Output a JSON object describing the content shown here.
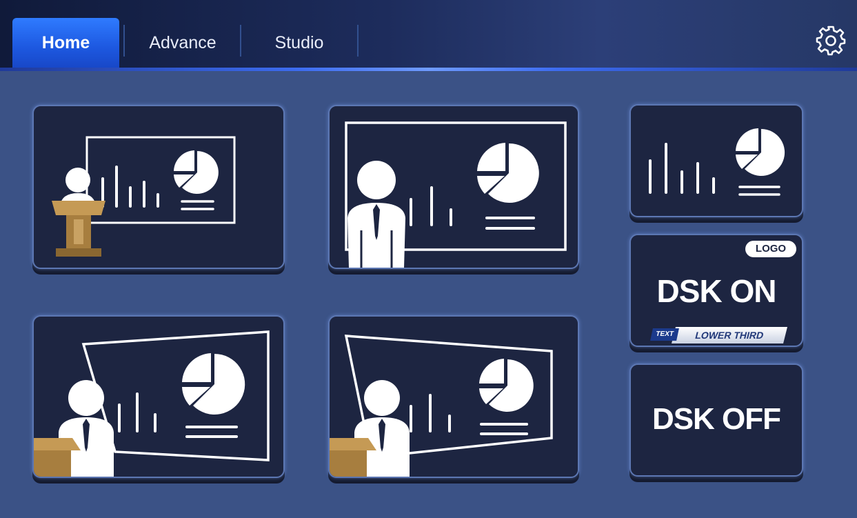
{
  "tabs": [
    {
      "label": "Home",
      "active": true
    },
    {
      "label": "Advance",
      "active": false
    },
    {
      "label": "Studio",
      "active": false
    }
  ],
  "settings_icon": "gear-icon",
  "layouts": [
    {
      "name": "presenter-podium-small-screen",
      "icons": [
        "presenter-icon",
        "podium-icon",
        "bar-chart-icon",
        "pie-chart-icon"
      ]
    },
    {
      "name": "presenter-large-screen",
      "icons": [
        "presenter-icon",
        "bar-chart-icon",
        "pie-chart-icon"
      ]
    },
    {
      "name": "screen-only",
      "icons": [
        "bar-chart-icon",
        "pie-chart-icon"
      ]
    },
    {
      "name": "presenter-podium-angled-screen-right",
      "icons": [
        "presenter-icon",
        "podium-icon",
        "bar-chart-icon",
        "pie-chart-icon"
      ]
    },
    {
      "name": "presenter-podium-angled-screen-left",
      "icons": [
        "presenter-icon",
        "podium-icon",
        "bar-chart-icon",
        "pie-chart-icon"
      ]
    }
  ],
  "dsk_on": {
    "title": "DSK ON",
    "logo_badge": "LOGO",
    "text_tag": "TEXT",
    "lower_third": "LOWER THIRD"
  },
  "dsk_off": {
    "title": "DSK OFF"
  },
  "colors": {
    "background": "#3b5286",
    "card": "#1d2541",
    "active_tab": "#2f7bff",
    "podium": "#b08a4a"
  }
}
